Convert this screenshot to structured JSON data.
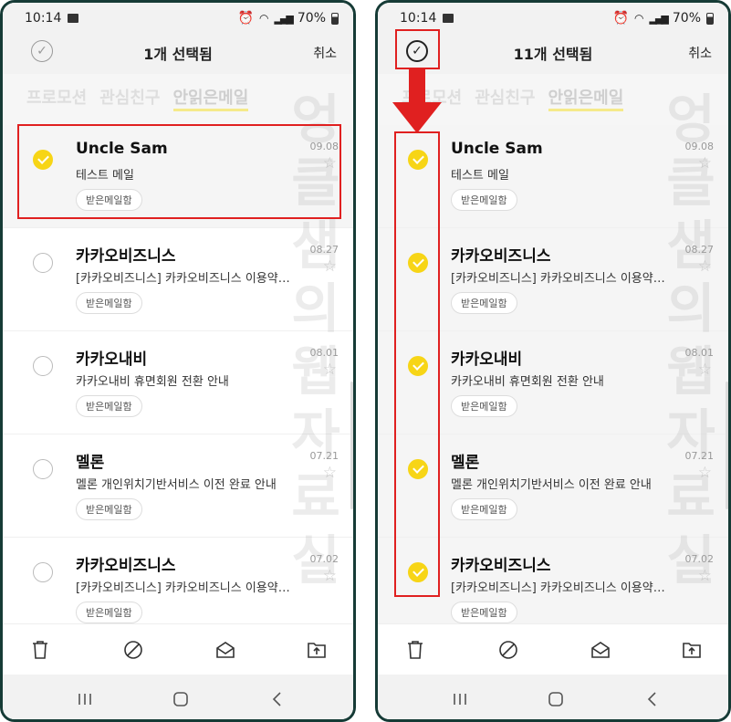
{
  "accent_color": "#f7d516",
  "annotation_color": "#e02020",
  "left": {
    "status": {
      "time": "10:14",
      "battery": "70%"
    },
    "appbar": {
      "selection_title": "1개 선택됨",
      "cancel_label": "취소",
      "check_all_state": "unchecked"
    },
    "tabs": [
      "프로모션",
      "관심친구",
      "안읽은메일"
    ],
    "mails": [
      {
        "sender": "Uncle Sam",
        "subject": "테스트 메일",
        "folder": "받은메일함",
        "date": "09.08",
        "checked": true
      },
      {
        "sender": "카카오비즈니스",
        "subject": "[카카오비즈니스] 카카오비즈니스 이용약…",
        "folder": "받은메일함",
        "date": "08.27",
        "checked": false
      },
      {
        "sender": "카카오내비",
        "subject": "카카오내비 휴면회원 전환 안내",
        "folder": "받은메일함",
        "date": "08.01",
        "checked": false
      },
      {
        "sender": "멜론",
        "subject": "멜론 개인위치기반서비스 이전 완료 안내",
        "folder": "받은메일함",
        "date": "07.21",
        "checked": false
      },
      {
        "sender": "카카오비즈니스",
        "subject": "[카카오비즈니스] 카카오비즈니스 이용약…",
        "folder": "받은메일함",
        "date": "07.02",
        "checked": false
      }
    ]
  },
  "right": {
    "status": {
      "time": "10:14",
      "battery": "70%"
    },
    "appbar": {
      "selection_title": "11개 선택됨",
      "cancel_label": "취소",
      "check_all_state": "checked"
    },
    "tabs": [
      "프로모션",
      "관심친구",
      "안읽은메일"
    ],
    "mails": [
      {
        "sender": "Uncle Sam",
        "subject": "테스트 메일",
        "folder": "받은메일함",
        "date": "09.08",
        "checked": true
      },
      {
        "sender": "카카오비즈니스",
        "subject": "[카카오비즈니스] 카카오비즈니스 이용약…",
        "folder": "받은메일함",
        "date": "08.27",
        "checked": true
      },
      {
        "sender": "카카오내비",
        "subject": "카카오내비 휴면회원 전환 안내",
        "folder": "받은메일함",
        "date": "08.01",
        "checked": true
      },
      {
        "sender": "멜론",
        "subject": "멜론 개인위치기반서비스 이전 완료 안내",
        "folder": "받은메일함",
        "date": "07.21",
        "checked": true
      },
      {
        "sender": "카카오비즈니스",
        "subject": "[카카오비즈니스] 카카오비즈니스 이용약…",
        "folder": "받은메일함",
        "date": "07.02",
        "checked": true
      }
    ]
  },
  "watermark": [
    "엉",
    "클",
    "샘",
    "의",
    "웹",
    "자",
    "료",
    "실"
  ],
  "toolbar_icons": [
    "trash-icon",
    "block-icon",
    "mail-read-icon",
    "move-folder-icon"
  ],
  "navbar_icons": [
    "recent-apps-icon",
    "home-icon",
    "back-icon"
  ]
}
